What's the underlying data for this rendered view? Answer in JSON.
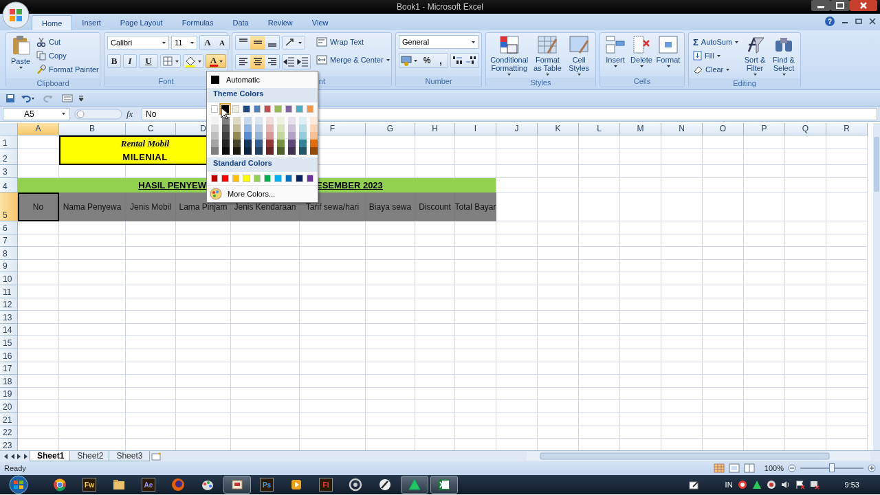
{
  "window": {
    "title": "Book1 - Microsoft Excel",
    "help": "?"
  },
  "ribbon_tabs": [
    {
      "label": "Home",
      "selected": true
    },
    {
      "label": "Insert",
      "selected": false
    },
    {
      "label": "Page Layout",
      "selected": false
    },
    {
      "label": "Formulas",
      "selected": false
    },
    {
      "label": "Data",
      "selected": false
    },
    {
      "label": "Review",
      "selected": false
    },
    {
      "label": "View",
      "selected": false
    }
  ],
  "ribbon": {
    "clipboard": {
      "paste": "Paste",
      "cut": "Cut",
      "copy": "Copy",
      "format_painter": "Format Painter",
      "label": "Clipboard"
    },
    "font": {
      "font_name": "Calibri",
      "font_size": "11",
      "grow": "A",
      "shrink": "A",
      "bold": "B",
      "italic": "I",
      "underline": "U",
      "font_color": "A",
      "font_color_open": true,
      "label": "Font"
    },
    "alignment": {
      "vertical": [
        {
          "selected": false
        },
        {
          "selected": true
        },
        {
          "selected": false
        }
      ],
      "horizontal": [
        {
          "selected": false
        },
        {
          "selected": true
        },
        {
          "selected": false
        }
      ],
      "wrap_text": "Wrap Text",
      "merge": "Merge & Center",
      "label": "nt"
    },
    "number": {
      "format": "General",
      "percent": "%",
      "comma": ",",
      "label": "Number"
    },
    "styles": {
      "buttons": [
        "Conditional Formatting",
        "Format as Table",
        "Cell Styles"
      ],
      "label": "Styles"
    },
    "cells": {
      "buttons": [
        "Insert",
        "Delete",
        "Format"
      ],
      "label": "Cells"
    },
    "editing": {
      "sigma": "Σ",
      "autosum": "AutoSum",
      "fill": "Fill",
      "clear": "Clear",
      "buttons": [
        "Sort & Filter",
        "Find & Select"
      ],
      "label": "Editing"
    }
  },
  "formula_bar": {
    "name_box": "A5",
    "fx": "fx",
    "value": "No"
  },
  "sheet": {
    "columns": [
      {
        "label": "A",
        "selected": true
      },
      {
        "label": "B",
        "selected": false
      },
      {
        "label": "C",
        "selected": false
      },
      {
        "label": "D",
        "selected": false
      },
      {
        "label": "F",
        "selected": false
      },
      {
        "label": "G",
        "selected": false
      },
      {
        "label": "H",
        "selected": false
      },
      {
        "label": "I",
        "selected": false
      },
      {
        "label": "J",
        "selected": false
      },
      {
        "label": "K",
        "selected": false
      },
      {
        "label": "L",
        "selected": false
      },
      {
        "label": "M",
        "selected": false
      },
      {
        "label": "N",
        "selected": false
      },
      {
        "label": "O",
        "selected": false
      },
      {
        "label": "P",
        "selected": false
      },
      {
        "label": "Q",
        "selected": false
      },
      {
        "label": "R",
        "selected": false
      }
    ],
    "rows": [
      {
        "label": "1",
        "selected": false
      },
      {
        "label": "2",
        "selected": false
      },
      {
        "label": "3",
        "selected": false
      },
      {
        "label": "4",
        "selected": false
      },
      {
        "label": "5",
        "selected": true
      },
      {
        "label": "6",
        "selected": false
      },
      {
        "label": "7",
        "selected": false
      },
      {
        "label": "8",
        "selected": false
      },
      {
        "label": "9",
        "selected": false
      },
      {
        "label": "10",
        "selected": false
      },
      {
        "label": "11",
        "selected": false
      },
      {
        "label": "12",
        "selected": false
      },
      {
        "label": "13",
        "selected": false
      },
      {
        "label": "14",
        "selected": false
      },
      {
        "label": "15",
        "selected": false
      },
      {
        "label": "16",
        "selected": false
      },
      {
        "label": "17",
        "selected": false
      },
      {
        "label": "18",
        "selected": false
      },
      {
        "label": "19",
        "selected": false
      },
      {
        "label": "20",
        "selected": false
      },
      {
        "label": "21",
        "selected": false
      },
      {
        "label": "22",
        "selected": false
      },
      {
        "label": "23",
        "selected": false
      }
    ],
    "title_box": {
      "line1": "Rental Mobil",
      "line2": "MILENIAL"
    },
    "banner": {
      "left": "HASIL PENYEW",
      "right": "ESEMBER 2023"
    },
    "header_row": [
      {
        "text": "No",
        "selected": true
      },
      {
        "text": "Nama Penyewa",
        "selected": false
      },
      {
        "text": "Jenis Mobil",
        "selected": false
      },
      {
        "text": "Lama Pinjam",
        "selected": false
      },
      {
        "text": "Jenis Kendaraan",
        "selected": false
      },
      {
        "text": "Tarif sewa/hari",
        "selected": false
      },
      {
        "text": "Biaya sewa",
        "selected": false
      },
      {
        "text": "Discount",
        "selected": false
      },
      {
        "text": "Total Bayar",
        "selected": false
      }
    ]
  },
  "font_color_menu": {
    "automatic": "Automatic",
    "theme_heading": "Theme Colors",
    "theme": [
      {
        "color": "#ffffff",
        "selected": false
      },
      {
        "color": "#000000",
        "selected": true
      },
      {
        "color": "#eeece1",
        "selected": false
      },
      {
        "color": "#1f497d",
        "selected": false
      },
      {
        "color": "#4f81bd",
        "selected": false
      },
      {
        "color": "#c0504d",
        "selected": false
      },
      {
        "color": "#9bbb59",
        "selected": false
      },
      {
        "color": "#8064a2",
        "selected": false
      },
      {
        "color": "#4bacc6",
        "selected": false
      },
      {
        "color": "#f79646",
        "selected": false
      }
    ],
    "shades": [
      {
        "colors": [
          {
            "color": "#f2f2f2"
          },
          {
            "color": "#d8d8d8"
          },
          {
            "color": "#bfbfbf"
          },
          {
            "color": "#a5a5a5"
          },
          {
            "color": "#7f7f7f"
          }
        ]
      },
      {
        "colors": [
          {
            "color": "#7f7f7f"
          },
          {
            "color": "#595959"
          },
          {
            "color": "#3f3f3f"
          },
          {
            "color": "#262626"
          },
          {
            "color": "#0c0c0c"
          }
        ]
      },
      {
        "colors": [
          {
            "color": "#ddd9c3"
          },
          {
            "color": "#c4bd97"
          },
          {
            "color": "#938953"
          },
          {
            "color": "#494429"
          },
          {
            "color": "#1d1b10"
          }
        ]
      },
      {
        "colors": [
          {
            "color": "#c6d9f0"
          },
          {
            "color": "#8db3e2"
          },
          {
            "color": "#548dd4"
          },
          {
            "color": "#17365d"
          },
          {
            "color": "#0f243e"
          }
        ]
      },
      {
        "colors": [
          {
            "color": "#dbe5f1"
          },
          {
            "color": "#b8cce4"
          },
          {
            "color": "#95b3d7"
          },
          {
            "color": "#366092"
          },
          {
            "color": "#244061"
          }
        ]
      },
      {
        "colors": [
          {
            "color": "#f2dcdb"
          },
          {
            "color": "#e5b9b7"
          },
          {
            "color": "#d99694"
          },
          {
            "color": "#953734"
          },
          {
            "color": "#632423"
          }
        ]
      },
      {
        "colors": [
          {
            "color": "#ebf1dd"
          },
          {
            "color": "#d7e3bc"
          },
          {
            "color": "#c3d69b"
          },
          {
            "color": "#76923c"
          },
          {
            "color": "#4f6128"
          }
        ]
      },
      {
        "colors": [
          {
            "color": "#e5e0ec"
          },
          {
            "color": "#ccc1d9"
          },
          {
            "color": "#b2a2c7"
          },
          {
            "color": "#5f497a"
          },
          {
            "color": "#3f3151"
          }
        ]
      },
      {
        "colors": [
          {
            "color": "#dbeef3"
          },
          {
            "color": "#b7dde8"
          },
          {
            "color": "#92cddc"
          },
          {
            "color": "#31859b"
          },
          {
            "color": "#205867"
          }
        ]
      },
      {
        "colors": [
          {
            "color": "#fdeada"
          },
          {
            "color": "#fbd5b5"
          },
          {
            "color": "#fac08f"
          },
          {
            "color": "#e36c09"
          },
          {
            "color": "#974806"
          }
        ]
      }
    ],
    "standard_heading": "Standard Colors",
    "standard": [
      {
        "color": "#c00000"
      },
      {
        "color": "#ff0000"
      },
      {
        "color": "#ffc000"
      },
      {
        "color": "#ffff00"
      },
      {
        "color": "#92d050"
      },
      {
        "color": "#00b050"
      },
      {
        "color": "#00b0f0"
      },
      {
        "color": "#0070c0"
      },
      {
        "color": "#002060"
      },
      {
        "color": "#7030a0"
      }
    ],
    "more": "More Colors..."
  },
  "sheet_tabs": [
    {
      "label": "Sheet1",
      "selected": true
    },
    {
      "label": "Sheet2",
      "selected": false
    },
    {
      "label": "Sheet3",
      "selected": false
    }
  ],
  "status_bar": {
    "status": "Ready",
    "zoom": "100%",
    "zoom_slider": {
      "level": 0.5
    }
  },
  "taskbar": {
    "apps": [
      {
        "active": false
      },
      {
        "active": false,
        "label": "Fw"
      },
      {
        "active": false
      },
      {
        "active": false,
        "label": "Ae"
      },
      {
        "active": false
      },
      {
        "active": false
      },
      {
        "active": true
      },
      {
        "active": false,
        "label": "Ps"
      },
      {
        "active": false
      },
      {
        "active": false,
        "label": "Fl"
      },
      {
        "active": false
      },
      {
        "active": false
      },
      {
        "active": true
      },
      {
        "active": true
      }
    ],
    "language": "IN",
    "clock": "9:53"
  }
}
